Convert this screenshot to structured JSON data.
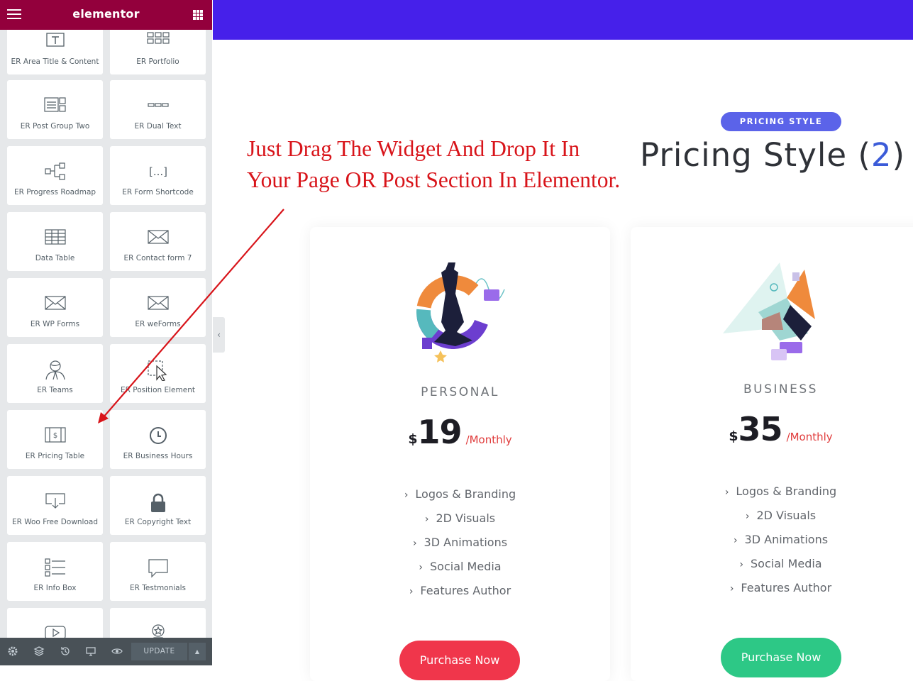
{
  "panel": {
    "brand": "elementor",
    "widgets": [
      {
        "label": "ER Area Title & Content",
        "icon": "text-block-icon"
      },
      {
        "label": "ER Portfolio",
        "icon": "portfolio-grid-icon"
      },
      {
        "label": "ER Post Group Two",
        "icon": "post-group-icon"
      },
      {
        "label": "ER Dual Text",
        "icon": "dual-text-icon"
      },
      {
        "label": "ER Progress Roadmap",
        "icon": "roadmap-icon"
      },
      {
        "label": "ER Form Shortcode",
        "icon": "shortcode-icon"
      },
      {
        "label": "Data Table",
        "icon": "table-icon"
      },
      {
        "label": "ER Contact form 7",
        "icon": "envelope-icon"
      },
      {
        "label": "ER WP Forms",
        "icon": "envelope-icon"
      },
      {
        "label": "ER weForms",
        "icon": "envelope-icon"
      },
      {
        "label": "ER Teams",
        "icon": "person-icon"
      },
      {
        "label": "ER Position Element",
        "icon": "position-icon"
      },
      {
        "label": "ER Pricing Table",
        "icon": "pricing-table-icon"
      },
      {
        "label": "ER Business Hours",
        "icon": "clock-icon"
      },
      {
        "label": "ER Woo Free Download",
        "icon": "download-icon"
      },
      {
        "label": "ER Copyright Text",
        "icon": "lock-icon"
      },
      {
        "label": "ER Info Box",
        "icon": "info-list-icon"
      },
      {
        "label": "ER Testmonials",
        "icon": "speech-bubble-icon"
      },
      {
        "label": "",
        "icon": "video-play-icon"
      },
      {
        "label": "",
        "icon": "award-badge-icon"
      }
    ],
    "bottom": {
      "icons": [
        "settings-icon",
        "layers-icon",
        "history-icon",
        "responsive-icon",
        "preview-eye-icon"
      ],
      "update_label": "UPDATE",
      "update_arrow": "▲"
    },
    "collapse_glyph": "‹"
  },
  "annotation": {
    "line1": "Just Drag The Widget And Drop It In",
    "line2": "Your Page OR Post Section In Elementor."
  },
  "section": {
    "badge": "PRICING STYLE",
    "title": "Pricing Style (",
    "title_accent": "2",
    "title_close": ")"
  },
  "cards": [
    {
      "plan": "PERSONAL",
      "currency": "$",
      "amount": "19",
      "period": "/Monthly",
      "features": [
        "Logos & Branding",
        "2D Visuals",
        "3D Animations",
        "Social Media",
        "Features Author"
      ],
      "button": "Purchase Now",
      "button_color": "#f0364b",
      "illustration": "chess-strategy-illustration"
    },
    {
      "plan": "BUSINESS",
      "currency": "$",
      "amount": "35",
      "period": "/Monthly",
      "features": [
        "Logos & Branding",
        "2D Visuals",
        "3D Animations",
        "Social Media",
        "Features Author"
      ],
      "button": "Purchase Now",
      "button_color": "#2dc886",
      "illustration": "megaphone-illustration"
    }
  ],
  "colors": {
    "elementor_bar": "#93003c",
    "hero_band": "#4620ea",
    "annotation": "#d8141a"
  }
}
